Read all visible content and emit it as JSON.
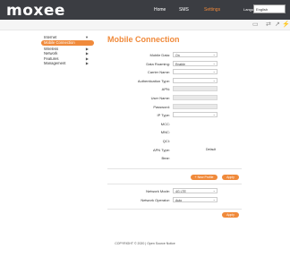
{
  "header": {
    "logo": "moxee",
    "nav": [
      "Home",
      "SMS",
      "Settings"
    ],
    "active_nav": "Settings",
    "language_label": "Language",
    "language_value": "English"
  },
  "sidebar": {
    "items": [
      {
        "label": "Internet",
        "chevron": "▼"
      },
      {
        "label": "Mobile Connection",
        "active": true
      },
      {
        "label": "Wireless",
        "chevron": "▶"
      },
      {
        "label": "Network",
        "chevron": "▶"
      },
      {
        "label": "Features",
        "chevron": "▶"
      },
      {
        "label": "Management",
        "chevron": "▶"
      }
    ]
  },
  "page": {
    "title": "Mobile Connection",
    "rows": [
      {
        "label": "Mobile Data:",
        "value": "On",
        "type": "select"
      },
      {
        "label": "Data Roaming:",
        "value": "Enable",
        "type": "select"
      },
      {
        "label": "Carrier Name:",
        "value": "",
        "type": "select"
      },
      {
        "label": "Authentication Type:",
        "value": "",
        "type": "select"
      },
      {
        "label": "APN:",
        "value": "",
        "type": "text"
      },
      {
        "label": "User Name:",
        "value": "",
        "type": "text"
      },
      {
        "label": "Password:",
        "value": "",
        "type": "text"
      },
      {
        "label": "IP Type:",
        "value": "",
        "type": "select"
      },
      {
        "label": "MCC:",
        "value": "",
        "type": "static"
      },
      {
        "label": "MNC:",
        "value": "",
        "type": "static"
      },
      {
        "label": "QCI:",
        "value": "",
        "type": "static"
      },
      {
        "label": "APN Type:",
        "value": "Default",
        "type": "static"
      },
      {
        "label": "Bear:",
        "value": "",
        "type": "static"
      }
    ],
    "new_profile_label": "New Profile",
    "apply_label": "Apply",
    "network_rows": [
      {
        "label": "Network Mode:",
        "value": "4G LTE",
        "type": "select"
      },
      {
        "label": "Network Operator:",
        "value": "Auto",
        "type": "select"
      }
    ],
    "apply2_label": "Apply"
  },
  "footer": {
    "copyright": "COPYRIGHT © 2020",
    "separator": "|",
    "notice": "Open Source Notice"
  },
  "colors": {
    "accent": "#f08a3b",
    "topbar": "#3b3d42"
  }
}
